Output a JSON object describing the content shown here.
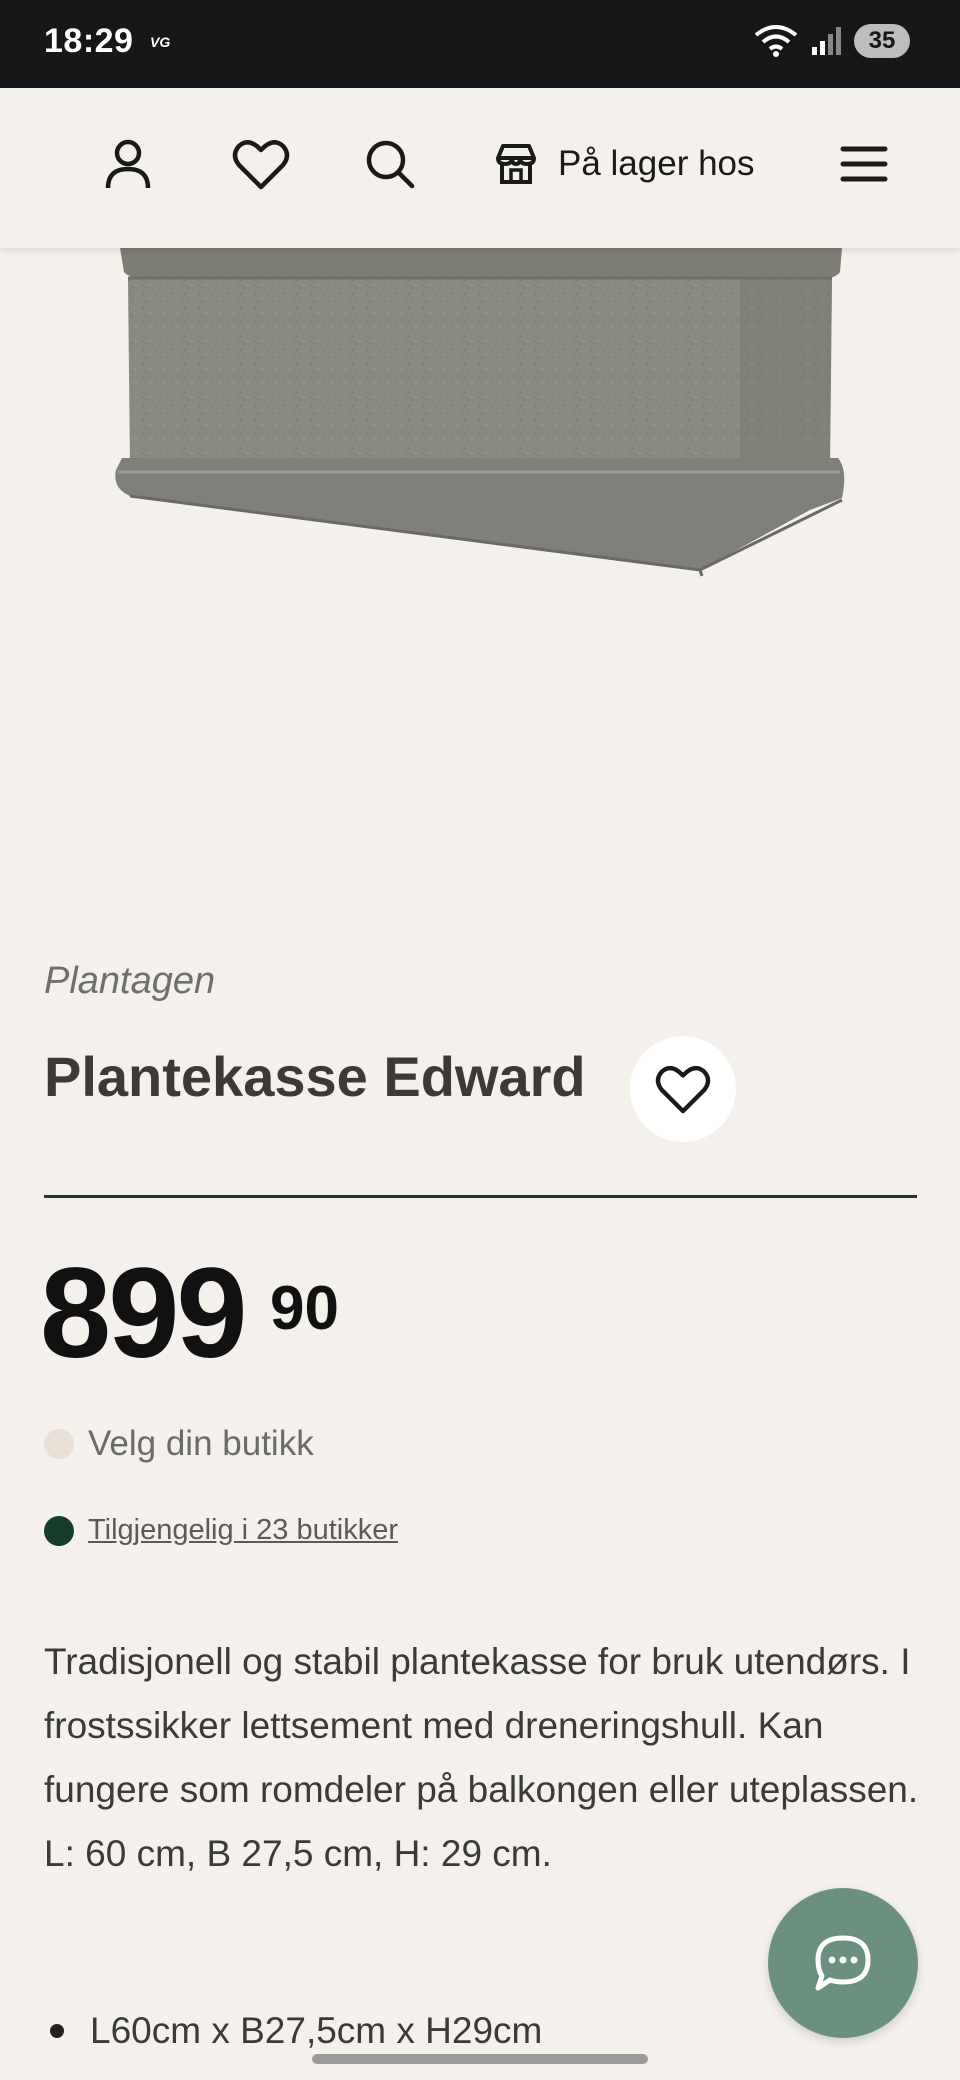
{
  "status_bar": {
    "time": "18:29",
    "carrier_badge": "VG",
    "battery": "35"
  },
  "nav": {
    "items": [
      {
        "icon": "user-icon"
      },
      {
        "icon": "heart-icon"
      },
      {
        "icon": "search-icon"
      },
      {
        "icon": "store-icon",
        "label": "På lager hos"
      },
      {
        "icon": "menu-icon"
      }
    ]
  },
  "product": {
    "brand": "Plantagen",
    "title": "Plantekasse Edward",
    "price_whole": "899",
    "price_cents": "90",
    "store_select": "Velg din butikk",
    "availability": "Tilgjengelig i 23 butikker",
    "description": "Tradisjonell og stabil plantekasse for bruk utendørs. I frostssikker lettsement med dreneringshull. Kan fungere som romdeler på balkongen eller uteplassen. L: 60 cm, B 27,5 cm, H: 29 cm.",
    "specs": [
      "L60cm x B27,5cm x H29cm"
    ]
  },
  "colors": {
    "background": "#f4f1ed",
    "divider": "#1f3a2a",
    "available_dot": "#163d2a",
    "store_dot": "#e8e0d6",
    "chat_button": "#6b9080",
    "planter": "#8a8a80"
  }
}
